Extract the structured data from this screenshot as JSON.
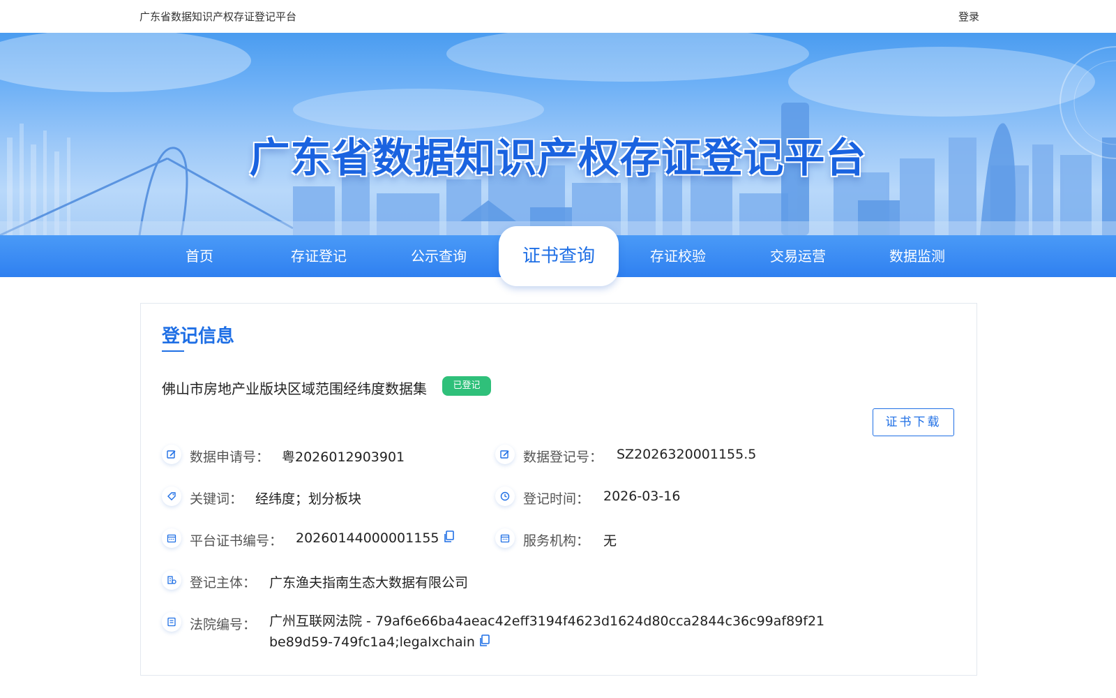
{
  "topbar": {
    "site_title": "广东省数据知识产权存证登记平台",
    "login": "登录"
  },
  "banner": {
    "title": "广东省数据知识产权存证登记平台"
  },
  "nav": {
    "items": [
      "首页",
      "存证登记",
      "公示查询",
      "证书查询",
      "存证校验",
      "交易运营",
      "数据监测"
    ],
    "active_index": 3
  },
  "record": {
    "section_title": "登记信息",
    "dataset_name": "佛山市房地产业版块区域范围经纬度数据集",
    "status": "已登记",
    "download": "证书下载",
    "fields": {
      "app_no_label": "数据申请号：",
      "app_no": "粤2026012903901",
      "reg_no_label": "数据登记号：",
      "reg_no": "SZ2026320001155.5",
      "keywords_label": "关键词：",
      "keywords": "经纬度；划分板块",
      "reg_time_label": "登记时间：",
      "reg_time": "2026-03-16",
      "cert_no_label": "平台证书编号：",
      "cert_no": "20260144000001155",
      "agency_label": "服务机构：",
      "agency": "无",
      "subject_label": "登记主体：",
      "subject": "广东渔夫指南生态大数据有限公司",
      "court_label": "法院编号：",
      "court_value": "广州互联网法院 - 79af6e66ba4aeac42eff3194f4623d1624d80cca2844c36c99af89f21be89d59-749fc1a4;legalxchain"
    }
  },
  "colors": {
    "primary": "#1f6fe5",
    "nav_bg": "#2f80f0",
    "badge_green": "#2fc07a"
  }
}
